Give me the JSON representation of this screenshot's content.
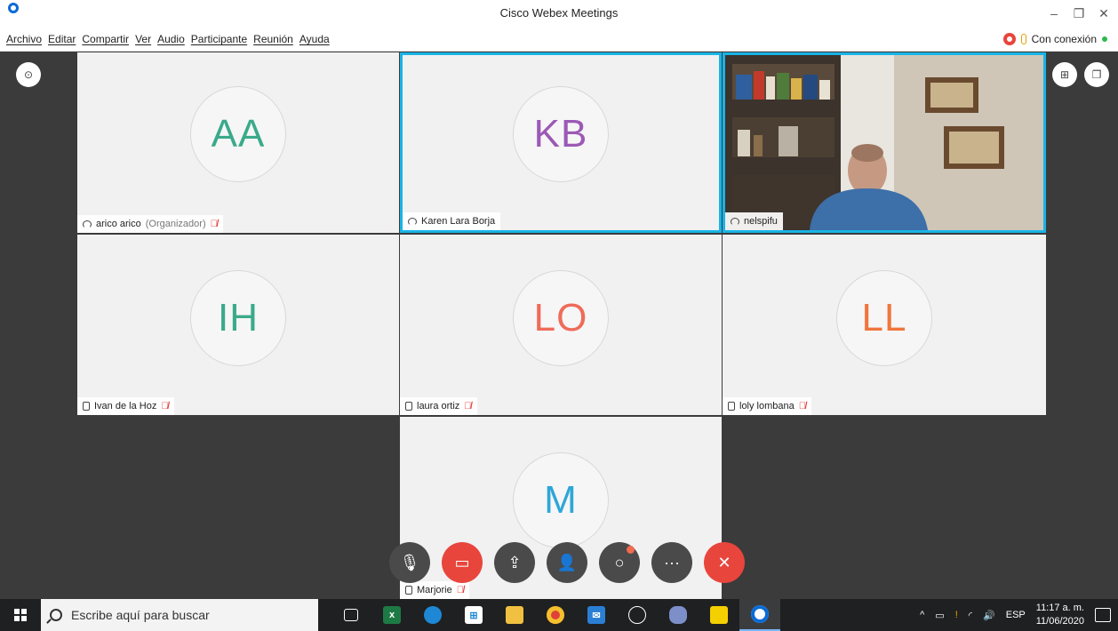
{
  "window": {
    "title": "Cisco Webex Meetings",
    "controls": [
      "–",
      "❐",
      "✕"
    ]
  },
  "menu": {
    "items": [
      "Archivo",
      "Editar",
      "Compartir",
      "Ver",
      "Audio",
      "Participante",
      "Reunión",
      "Ayuda"
    ],
    "connection_status": "Con conexión"
  },
  "participants": [
    {
      "initials": "AA",
      "name": "arico arico",
      "role": "(Organizador)",
      "color": "#3aaa8a",
      "muted": true,
      "audio": "computer"
    },
    {
      "initials": "KB",
      "name": "Karen Lara Borja",
      "color": "#9b59b6",
      "muted": false,
      "audio": "computer",
      "active": true
    },
    {
      "initials": "",
      "name": "nelspifu",
      "video": true,
      "muted": false,
      "audio": "computer",
      "active": true
    },
    {
      "initials": "IH",
      "name": "Ivan de la Hoz",
      "color": "#3aaa8a",
      "muted": true,
      "audio": "phone"
    },
    {
      "initials": "LO",
      "name": "laura ortiz",
      "color": "#ef6b5a",
      "muted": true,
      "audio": "phone"
    },
    {
      "initials": "LL",
      "name": "loly lombana",
      "color": "#f0763c",
      "muted": true,
      "audio": "phone"
    },
    {
      "initials": "M",
      "name": "Marjorie",
      "color": "#2ea6d8",
      "muted": true,
      "audio": "phone"
    }
  ],
  "controls": [
    {
      "name": "mute-button",
      "icon": "mic-off-icon",
      "glyph": "🎙"
    },
    {
      "name": "video-button",
      "icon": "video-off-icon",
      "glyph": "▭"
    },
    {
      "name": "share-button",
      "icon": "share-icon",
      "glyph": "⇪"
    },
    {
      "name": "participants-button",
      "icon": "participants-icon",
      "glyph": "👤"
    },
    {
      "name": "chat-button",
      "icon": "chat-icon",
      "glyph": "○"
    },
    {
      "name": "more-button",
      "icon": "more-icon",
      "glyph": "···"
    },
    {
      "name": "leave-button",
      "icon": "close-icon",
      "glyph": "✕"
    }
  ],
  "taskbar": {
    "search_placeholder": "Escribe aquí para buscar",
    "language": "ESP",
    "time": "11:17 a. m.",
    "date": "11/06/2020"
  }
}
